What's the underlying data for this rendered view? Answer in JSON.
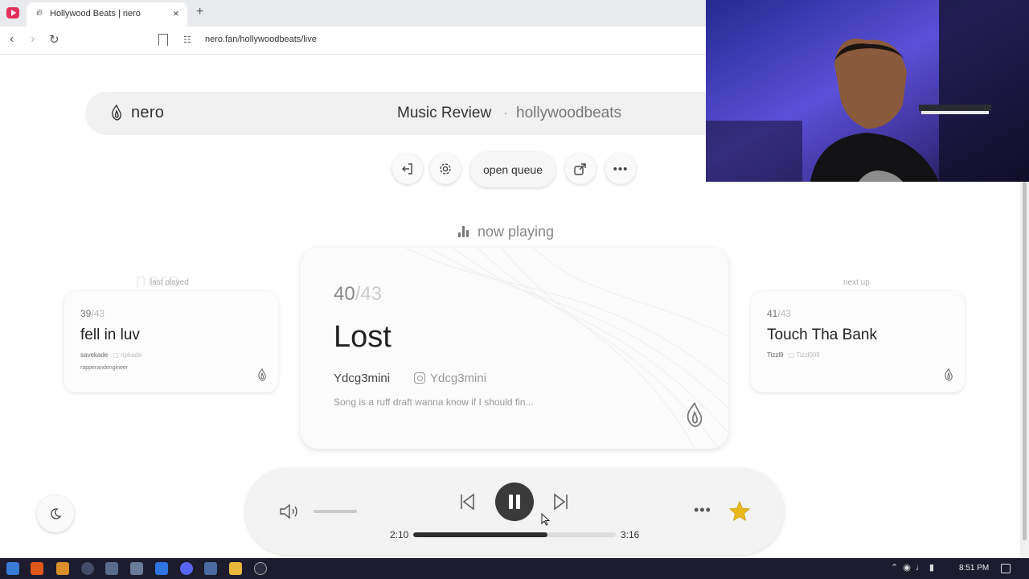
{
  "browser": {
    "tab_title": "Hollywood Beats | nero",
    "tab_close": "×",
    "new_tab": "+",
    "url": "nero.fan/hollywoodbeats/live"
  },
  "header": {
    "logo": "nero",
    "title": "Music Review",
    "separator": "·",
    "channel": "hollywoodbeats"
  },
  "actions": {
    "open_queue": "open queue"
  },
  "now_playing_label": "now playing",
  "last_played": {
    "caption": "last played",
    "watermark": "nero",
    "position": "39",
    "total": "/43",
    "title": "fell in luv",
    "artist": "savekade",
    "instagram": "ripkade",
    "subtitle": "rapperandengineer"
  },
  "current": {
    "position": "40",
    "total": "/43",
    "title": "Lost",
    "artist": "Ydcg3mini",
    "instagram": "Ydcg3mini",
    "description": "Song is a ruff draft wanna know if I should fin..."
  },
  "next_up": {
    "caption": "next up",
    "position": "41",
    "total": "/43",
    "title": "Touch Tha Bank",
    "artist": "Tizzl9",
    "instagram": "Tizzl009"
  },
  "player": {
    "elapsed": "2:10",
    "duration": "3:16",
    "progress_fraction": 0.663,
    "volume_level": "muted-looking slider",
    "more": "•••",
    "star_color": "#e8b81a"
  },
  "taskbar": {
    "clock": "8:51 PM"
  },
  "colors": {
    "accent_dark": "#3a3a3a",
    "card_bg": "#fbfbfb",
    "header_bg": "#f1f1f1"
  }
}
